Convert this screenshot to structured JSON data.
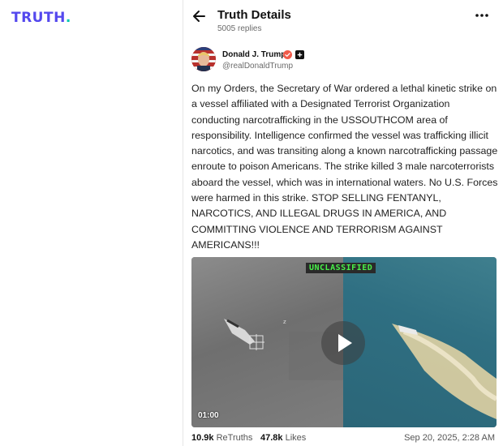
{
  "brand": {
    "logo_text": "TRUTH",
    "logo_dot": ".",
    "brand_color": "#5448ee",
    "accent_color": "#00c7b1"
  },
  "header": {
    "back_icon": "arrow-left-icon",
    "title": "Truth Details",
    "replies": "5005 replies",
    "more_icon": "more-horizontal-icon"
  },
  "author": {
    "name": "Donald J. Trump",
    "handle": "@realDonaldTrump",
    "verified_icon": "verified-badge-icon",
    "verified_color": "#f05a4a",
    "follow_icon": "plus-icon"
  },
  "post": {
    "text": "On my Orders, the Secretary of War ordered a lethal kinetic strike on a vessel affiliated with a Designated Terrorist Organization conducting narcotrafficking in the USSOUTHCOM area of responsibility. Intelligence confirmed the vessel was trafficking illicit narcotics, and was transiting along a known narcotrafficking passage enroute to poison Americans. The strike killed 3 male narcoterrorists aboard the vessel, which was in international waters. No U.S. Forces were harmed in this strike. STOP SELLING FENTANYL, NARCOTICS, AND ILLEGAL DRUGS IN AMERICA, AND COMMITTING VIOLENCE AND TERRORISM AGAINST AMERICANS!!!"
  },
  "media": {
    "overlay_label": "UNCLASSIFIED",
    "duration": "01:00",
    "play_icon": "play-icon"
  },
  "stats": {
    "retruths_count": "10.9k",
    "retruths_label": "ReTruths",
    "likes_count": "47.8k",
    "likes_label": "Likes",
    "timestamp": "Sep 20, 2025, 2:28 AM"
  }
}
